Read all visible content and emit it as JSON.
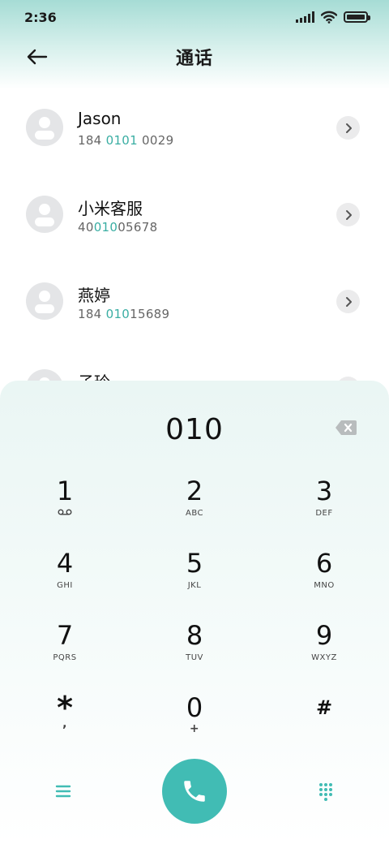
{
  "status_bar": {
    "time": "2:36"
  },
  "header": {
    "title": "通话"
  },
  "contacts": [
    {
      "name": "Jason",
      "number_pre": "184 ",
      "number_match": "0101",
      "number_post": " 0029"
    },
    {
      "name": "小米客服",
      "number_pre": "40",
      "number_match": "010",
      "number_post": "05678"
    },
    {
      "name": "燕婷",
      "number_pre": "184 ",
      "number_match": "010",
      "number_post": "15689"
    },
    {
      "name": "子玲",
      "number_pre": "",
      "number_match": "",
      "number_post": ""
    }
  ],
  "dialer": {
    "input": "010",
    "keys": [
      {
        "digit": "1",
        "letters": ""
      },
      {
        "digit": "2",
        "letters": "ABC"
      },
      {
        "digit": "3",
        "letters": "DEF"
      },
      {
        "digit": "4",
        "letters": "GHI"
      },
      {
        "digit": "5",
        "letters": "JKL"
      },
      {
        "digit": "6",
        "letters": "MNO"
      },
      {
        "digit": "7",
        "letters": "PQRS"
      },
      {
        "digit": "8",
        "letters": "TUV"
      },
      {
        "digit": "9",
        "letters": "WXYZ"
      },
      {
        "digit": "*",
        "letters": ","
      },
      {
        "digit": "0",
        "letters": "+"
      },
      {
        "digit": "#",
        "letters": ""
      }
    ]
  },
  "colors": {
    "accent": "#41bcb4",
    "highlight_text": "#3aaea3",
    "header_gradient_top": "#a6dcd5"
  },
  "icons": {
    "back": "arrow-left-icon",
    "voicemail": "voicemail-icon",
    "backspace": "backspace-icon",
    "menu": "menu-icon",
    "call": "phone-icon",
    "keypad": "dialpad-icon",
    "detail": "chevron-right-icon"
  }
}
